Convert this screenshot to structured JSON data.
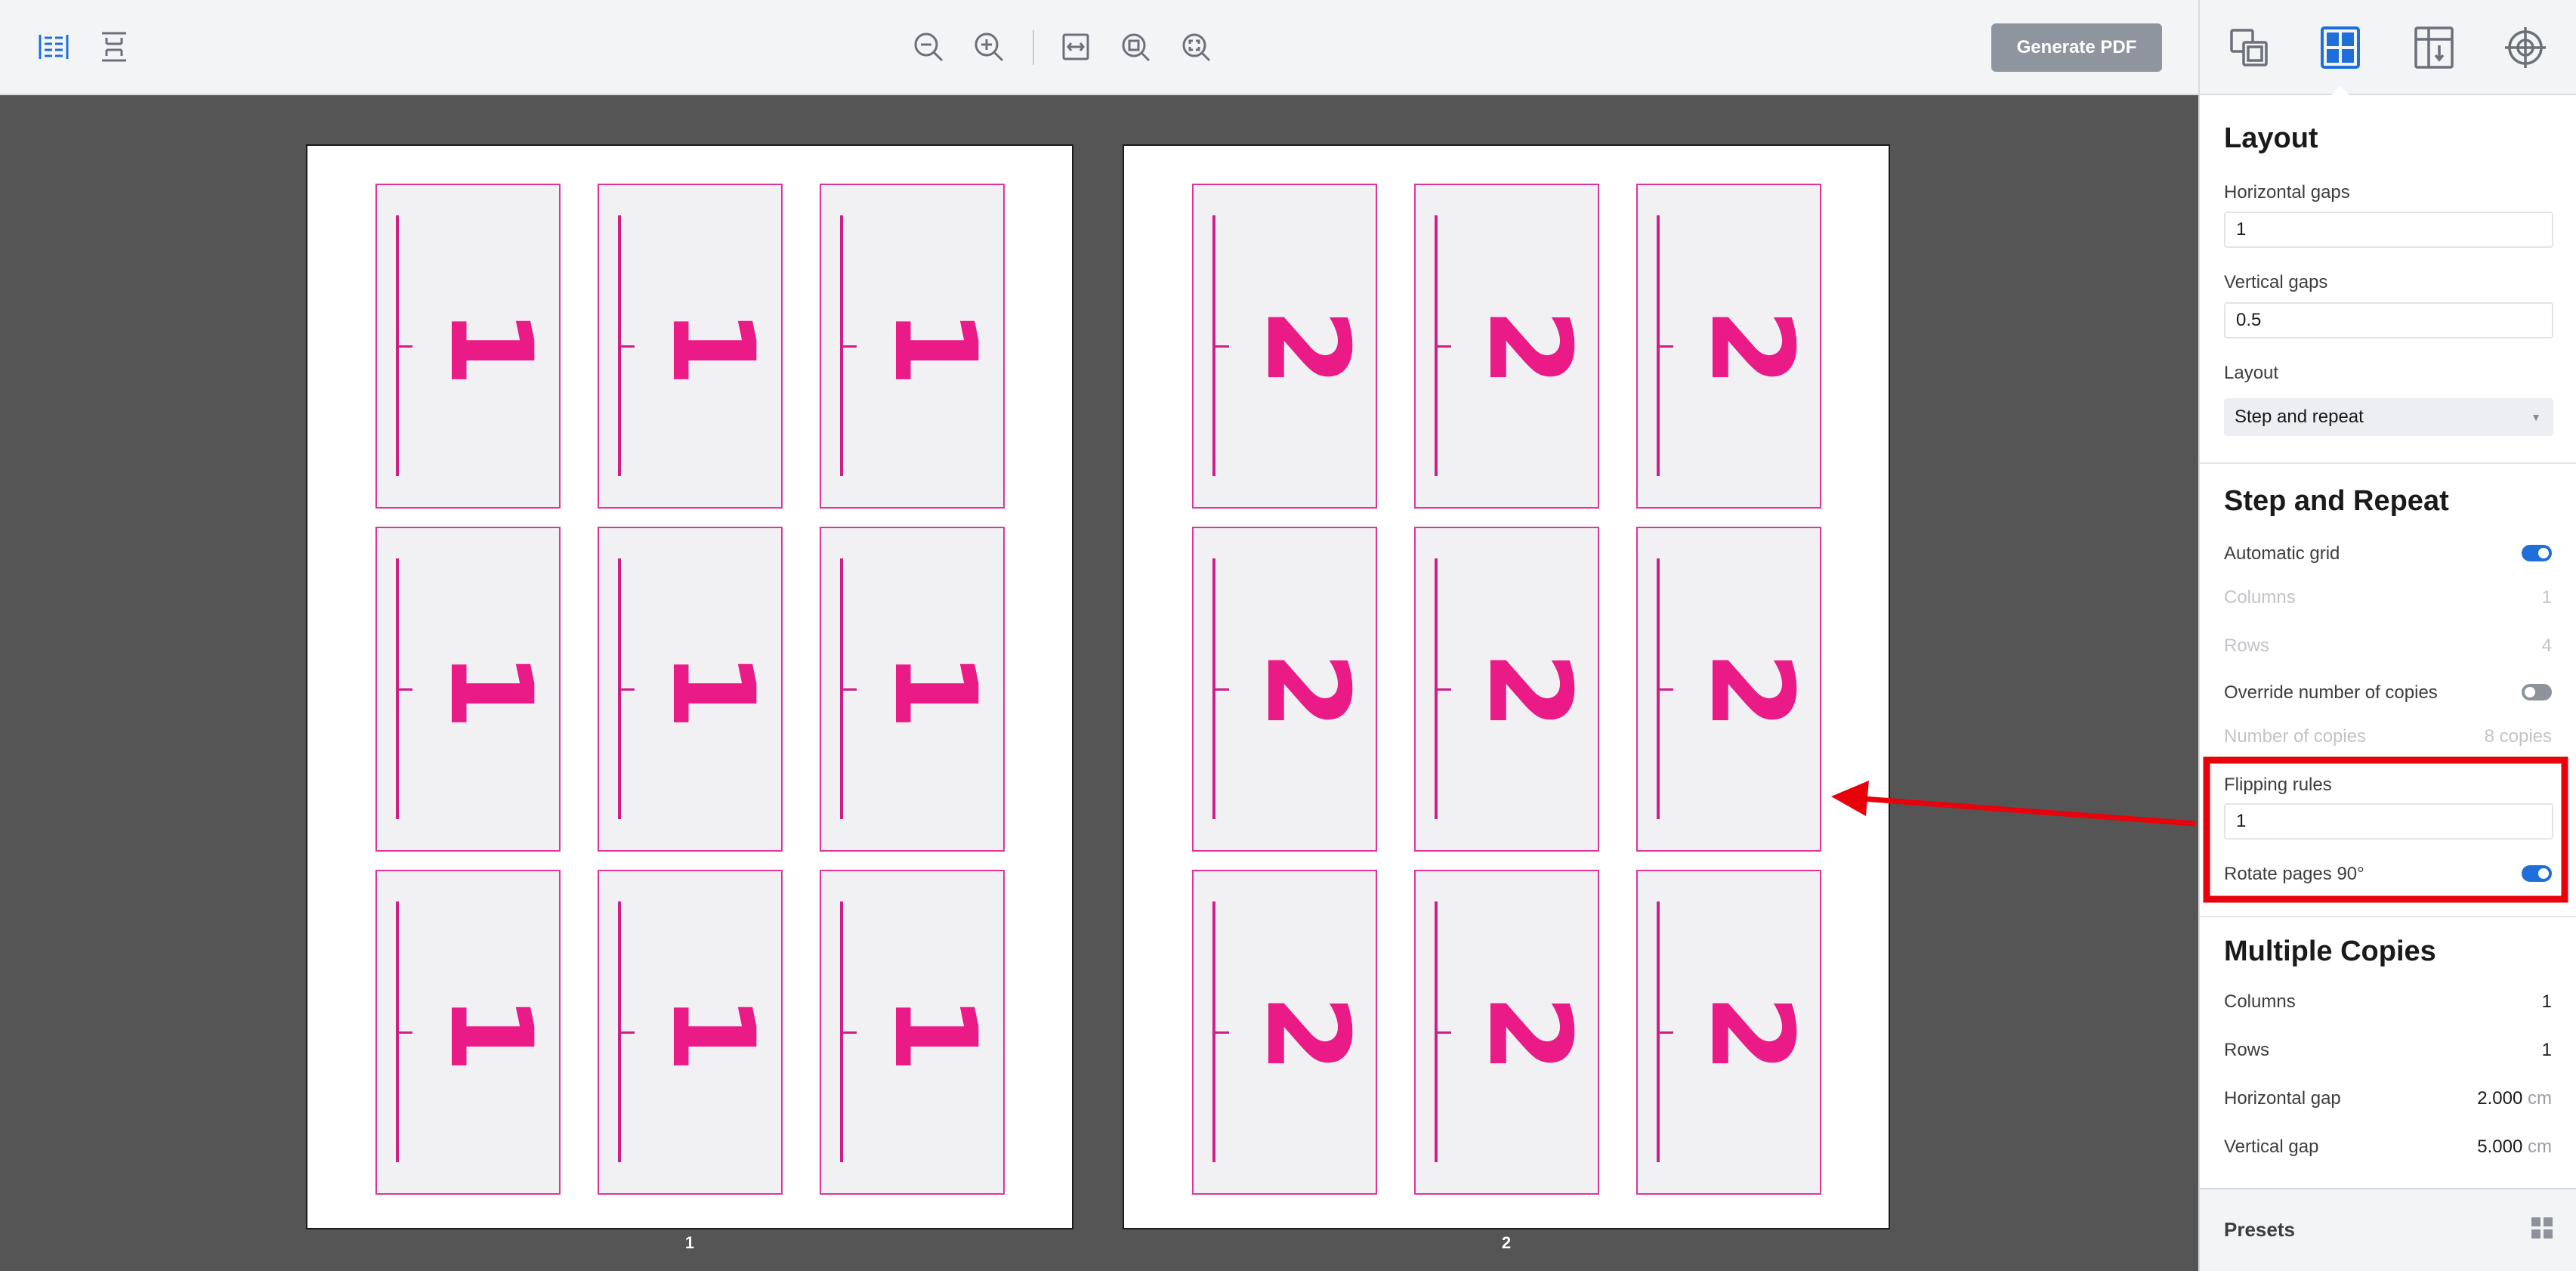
{
  "toolbar": {
    "left_icons": [
      "two-page-view-icon",
      "single-page-view-icon"
    ],
    "zoom_icons": [
      "zoom-out-icon",
      "zoom-in-icon",
      "fit-width-icon",
      "zoom-actual-icon",
      "zoom-fit-icon"
    ],
    "generate_pdf": "Generate PDF"
  },
  "panel_tabs": [
    "pages-icon",
    "layout-icon",
    "crop-marks-icon",
    "registration-icon"
  ],
  "canvas": {
    "pages": [
      {
        "number": "1",
        "digit": "1"
      },
      {
        "number": "2",
        "digit": "2"
      }
    ]
  },
  "layout": {
    "title": "Layout",
    "horizontal_gaps_label": "Horizontal gaps",
    "horizontal_gaps_value": "1",
    "vertical_gaps_label": "Vertical gaps",
    "vertical_gaps_value": "0.5",
    "layout_label": "Layout",
    "layout_value": "Step and repeat"
  },
  "step_repeat": {
    "title": "Step and Repeat",
    "automatic_grid_label": "Automatic grid",
    "automatic_grid": true,
    "columns_label": "Columns",
    "columns_value": "1",
    "rows_label": "Rows",
    "rows_value": "4",
    "override_copies_label": "Override number of copies",
    "override_copies": false,
    "number_of_copies_label": "Number of copies",
    "number_of_copies_value": "8 copies",
    "flipping_rules_label": "Flipping rules",
    "flipping_rules_value": "1",
    "rotate_pages_label": "Rotate pages 90°",
    "rotate_pages": true
  },
  "multiple_copies": {
    "title": "Multiple Copies",
    "columns_label": "Columns",
    "columns_value": "1",
    "rows_label": "Rows",
    "rows_value": "1",
    "horizontal_gap_label": "Horizontal gap",
    "horizontal_gap_value": "2.000",
    "vertical_gap_label": "Vertical gap",
    "vertical_gap_value": "5.000",
    "unit": "cm"
  },
  "presets": {
    "label": "Presets",
    "icon": "grid-icon"
  },
  "colors": {
    "accent": "#1e6fd9",
    "mark": "#e0349b",
    "highlight": "#e8000b"
  }
}
